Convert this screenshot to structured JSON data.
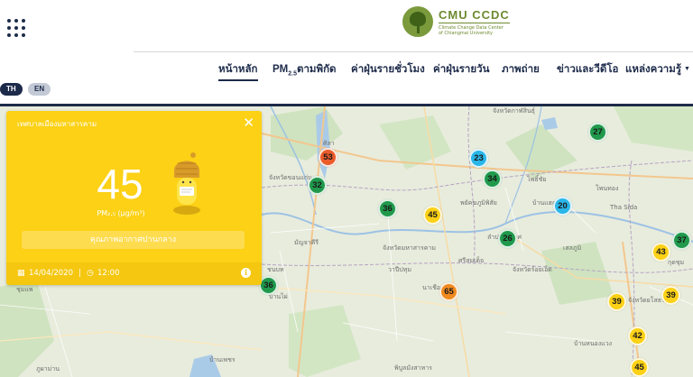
{
  "header": {
    "logo_title": "CMU CCDC",
    "logo_subtitle_1": "Climate Change Data Center",
    "logo_subtitle_2": "of Chiangmai University",
    "nav": [
      {
        "label": "หน้าหลัก",
        "active": true
      },
      {
        "label_pre": "PM",
        "label_sub": "2.5",
        "label_post": "ตามพิกัด"
      },
      {
        "label": "ค่าฝุ่นรายชั่วโมง"
      },
      {
        "label": "ค่าฝุ่นรายวัน"
      },
      {
        "label": "ภาพถ่าย"
      },
      {
        "label": "ข่าวและวีดีโอ"
      },
      {
        "label": "แหล่งความรู้"
      }
    ],
    "lang_th": "TH",
    "lang_en": "EN"
  },
  "card": {
    "station": "เทศบาลเมืองมหาสารคาม",
    "value": "45",
    "unit": "PM₂.₅ (µg/m³)",
    "status": "คุณภาพอากาศปานกลาง",
    "date": "14/04/2020",
    "separator": "|",
    "time": "12:00",
    "theme_color": "#fcd116"
  },
  "map": {
    "labels": [
      {
        "text": "จังหวัดกาฬสินธุ์"
      },
      {
        "text": "จังหวัดขอนแก่น"
      },
      {
        "text": "จังหวัดมหาสารคาม"
      },
      {
        "text": "จังหวัดร้อยเอ็ด"
      },
      {
        "text": "จังหวัดยโสธร"
      },
      {
        "text": "มัญจาคีรี"
      },
      {
        "text": "พิบูลมังสาหาร"
      },
      {
        "text": "ลำปลายมาศ"
      },
      {
        "text": "Tha Sida"
      },
      {
        "text": "พยัคฆภูมิพิสัย"
      },
      {
        "text": "ภูผาม่าน"
      },
      {
        "text": "ชุมแพ"
      },
      {
        "text": "ศิลา"
      },
      {
        "text": "โพธิ์ชัย"
      },
      {
        "text": "โพนทอง"
      },
      {
        "text": "เสลภูมิ"
      },
      {
        "text": "บ้านแฮด"
      },
      {
        "text": "ชนบท"
      },
      {
        "text": "กุดชุม"
      },
      {
        "text": "บ้านหนองแวง"
      },
      {
        "text": "บ้านไผ่"
      },
      {
        "text": "นาเชือก"
      },
      {
        "text": "วาปีปทุม"
      },
      {
        "text": "ศรีสมเด็จ"
      },
      {
        "text": "บ้านเพชร"
      }
    ],
    "markers": [
      {
        "value": "53",
        "level": "red"
      },
      {
        "value": "32",
        "level": "green"
      },
      {
        "value": "36",
        "level": "green"
      },
      {
        "value": "45",
        "level": "yellow"
      },
      {
        "value": "23",
        "level": "blue"
      },
      {
        "value": "34",
        "level": "green"
      },
      {
        "value": "27",
        "level": "green"
      },
      {
        "value": "20",
        "level": "blue"
      },
      {
        "value": "26",
        "level": "green"
      },
      {
        "value": "36",
        "level": "green"
      },
      {
        "value": "65",
        "level": "orange"
      },
      {
        "value": "43",
        "level": "yellow"
      },
      {
        "value": "37",
        "level": "green"
      },
      {
        "value": "39",
        "level": "yellow"
      },
      {
        "value": "39",
        "level": "yellow"
      },
      {
        "value": "42",
        "level": "yellow"
      },
      {
        "value": "45",
        "level": "yellow"
      }
    ]
  }
}
